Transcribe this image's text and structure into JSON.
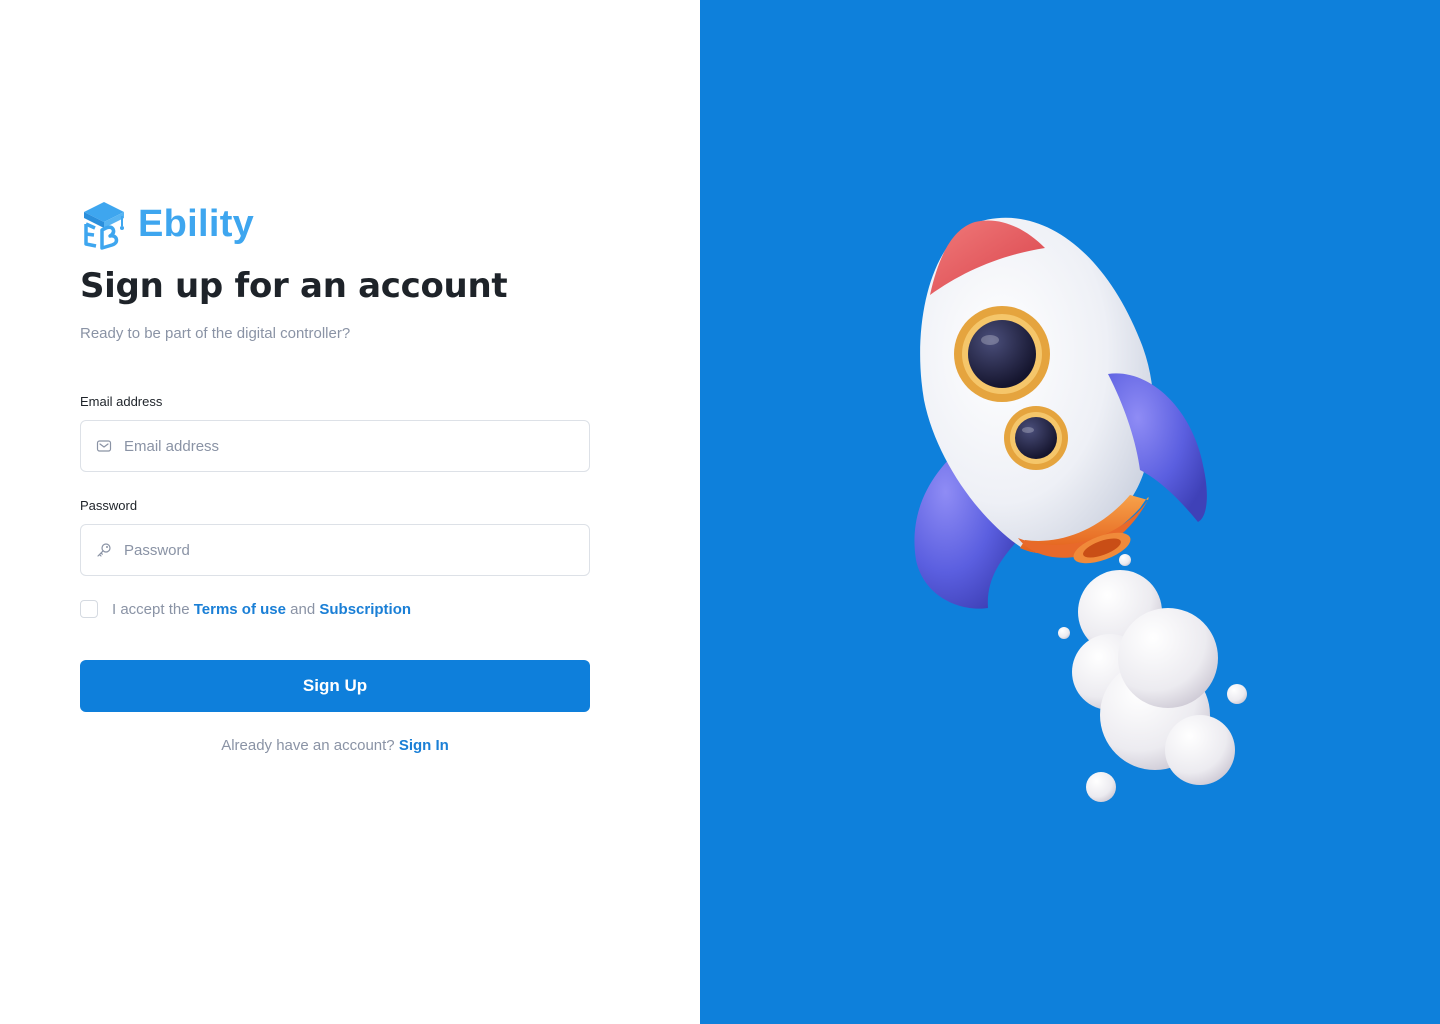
{
  "brand": {
    "name": "Ebility",
    "icon": "graduation-cap-logo",
    "color": "#3ea6ef"
  },
  "form": {
    "title": "Sign up for an account",
    "subtitle": "Ready to be part of the digital controller?",
    "email": {
      "label": "Email address",
      "placeholder": "Email address",
      "value": "",
      "icon": "mail-icon"
    },
    "password": {
      "label": "Password",
      "placeholder": "Password",
      "value": "",
      "icon": "key-icon"
    },
    "accept": {
      "checked": false,
      "prefix": "I accept the",
      "terms_link": "Terms of use",
      "conjunction": "and",
      "subscription_link": "Subscription"
    },
    "submit_label": "Sign Up",
    "signin": {
      "prompt": "Already have an account?",
      "link": "Sign In"
    }
  },
  "hero": {
    "background_color": "#0e80db",
    "illustration": "rocket-illustration"
  },
  "colors": {
    "primary": "#0e7fdb",
    "link": "#1a7fd6",
    "heading": "#1e2329",
    "muted": "#8a93a5"
  }
}
